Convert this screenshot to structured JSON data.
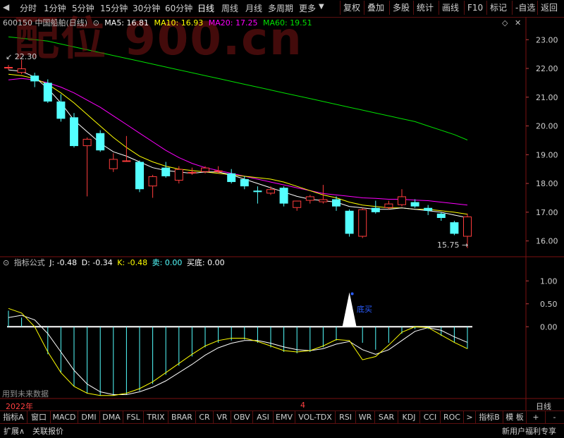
{
  "toolbar": {
    "periods": [
      "分时",
      "1分钟",
      "5分钟",
      "15分钟",
      "30分钟",
      "60分钟",
      "日线",
      "周线",
      "月线",
      "多周期",
      "更多"
    ],
    "right_buttons": [
      "复权",
      "叠加",
      "多股",
      "统计",
      "画线",
      "F10",
      "标记",
      "-自选",
      "返回"
    ]
  },
  "watermark": "配位 900.cn",
  "header": {
    "code_name": "600150 中国船舶(日线)",
    "ma5": "MA5: 16.81",
    "ma10": "MA10: 16.93",
    "ma20": "MA20: 17.25",
    "ma60": "MA60: 19.51"
  },
  "price_axis": [
    "23.00",
    "22.00",
    "21.00",
    "20.00",
    "19.00",
    "18.00",
    "17.00",
    "16.00"
  ],
  "annotations": {
    "high": "22.30",
    "low": "15.75"
  },
  "indicator": {
    "title": "指标公式",
    "j": "J: -0.48",
    "d": "D: -0.34",
    "k": "K: -0.48",
    "sell": "卖: 0.00",
    "buy_bottom": "买底: 0.00",
    "signal_label": "底买",
    "axis": [
      "1.00",
      "0.50",
      "0.00"
    ],
    "future_note": "用到未来数据"
  },
  "date_axis": {
    "year": "2022年",
    "month": "4",
    "period": "日线"
  },
  "tabs": [
    "指标A",
    "窗口",
    "MACD",
    "DMI",
    "DMA",
    "FSL",
    "TRIX",
    "BRAR",
    "CR",
    "VR",
    "OBV",
    "ASI",
    "EMV",
    "VOL-TDX",
    "RSI",
    "WR",
    "SAR",
    "KDJ",
    "CCI",
    "ROC",
    ">",
    "指标B",
    "模 板",
    "+",
    "-"
  ],
  "status": {
    "left1": "扩展∧",
    "left2": "关联报价",
    "right": "新用户福利专享"
  },
  "colors": {
    "up": "#ff3c3c",
    "down": "#54ffff",
    "ma5": "#ffffff",
    "ma10": "#ffff00",
    "ma20": "#ff00ff",
    "ma60": "#00e000",
    "grid": "#7a1010"
  },
  "chart_data": {
    "type": "candlestick",
    "price_range": [
      15.5,
      23.35
    ],
    "candles": [
      {
        "o": 22.05,
        "h": 22.12,
        "l": 21.95,
        "c": 22.05
      },
      {
        "o": 21.85,
        "h": 22.3,
        "l": 21.8,
        "c": 22.0
      },
      {
        "o": 21.75,
        "h": 21.85,
        "l": 21.35,
        "c": 21.55
      },
      {
        "o": 21.5,
        "h": 21.62,
        "l": 20.8,
        "c": 20.85
      },
      {
        "o": 20.85,
        "h": 21.1,
        "l": 20.15,
        "c": 20.25
      },
      {
        "o": 20.3,
        "h": 20.45,
        "l": 19.25,
        "c": 19.3
      },
      {
        "o": 19.3,
        "h": 19.6,
        "l": 17.55,
        "c": 19.55
      },
      {
        "o": 19.75,
        "h": 19.85,
        "l": 19.1,
        "c": 19.15
      },
      {
        "o": 18.5,
        "h": 19.05,
        "l": 18.4,
        "c": 18.85
      },
      {
        "o": 18.8,
        "h": 19.65,
        "l": 18.75,
        "c": 18.8
      },
      {
        "o": 18.75,
        "h": 18.8,
        "l": 17.7,
        "c": 17.8
      },
      {
        "o": 17.9,
        "h": 18.3,
        "l": 17.5,
        "c": 18.25
      },
      {
        "o": 18.55,
        "h": 18.75,
        "l": 18.2,
        "c": 18.25
      },
      {
        "o": 18.1,
        "h": 18.6,
        "l": 18.0,
        "c": 18.5
      },
      {
        "o": 18.35,
        "h": 18.55,
        "l": 18.3,
        "c": 18.4
      },
      {
        "o": 18.4,
        "h": 18.6,
        "l": 18.35,
        "c": 18.55
      },
      {
        "o": 18.4,
        "h": 18.6,
        "l": 18.35,
        "c": 18.45
      },
      {
        "o": 18.35,
        "h": 18.5,
        "l": 18.0,
        "c": 18.05
      },
      {
        "o": 18.15,
        "h": 18.25,
        "l": 17.8,
        "c": 17.9
      },
      {
        "o": 17.75,
        "h": 17.9,
        "l": 17.3,
        "c": 17.7
      },
      {
        "o": 17.65,
        "h": 17.9,
        "l": 17.6,
        "c": 17.8
      },
      {
        "o": 17.85,
        "h": 17.9,
        "l": 17.2,
        "c": 17.3
      },
      {
        "o": 17.15,
        "h": 17.4,
        "l": 17.05,
        "c": 17.4
      },
      {
        "o": 17.4,
        "h": 17.6,
        "l": 17.3,
        "c": 17.55
      },
      {
        "o": 17.35,
        "h": 17.95,
        "l": 17.3,
        "c": 17.45
      },
      {
        "o": 17.45,
        "h": 17.55,
        "l": 17.05,
        "c": 17.2
      },
      {
        "o": 17.05,
        "h": 17.1,
        "l": 16.15,
        "c": 16.25
      },
      {
        "o": 16.15,
        "h": 17.15,
        "l": 16.1,
        "c": 17.1
      },
      {
        "o": 17.15,
        "h": 17.4,
        "l": 16.95,
        "c": 17.0
      },
      {
        "o": 17.15,
        "h": 17.4,
        "l": 17.1,
        "c": 17.3
      },
      {
        "o": 17.25,
        "h": 17.8,
        "l": 17.2,
        "c": 17.55
      },
      {
        "o": 17.35,
        "h": 17.45,
        "l": 17.15,
        "c": 17.2
      },
      {
        "o": 17.15,
        "h": 17.25,
        "l": 16.9,
        "c": 17.05
      },
      {
        "o": 16.95,
        "h": 17.0,
        "l": 16.7,
        "c": 16.8
      },
      {
        "o": 16.65,
        "h": 16.7,
        "l": 16.2,
        "c": 16.25
      },
      {
        "o": 16.15,
        "h": 16.95,
        "l": 15.75,
        "c": 16.85
      }
    ],
    "ma5": [
      21.95,
      21.9,
      21.7,
      21.3,
      20.8,
      20.2,
      19.8,
      19.4,
      19.1,
      18.95,
      18.75,
      18.55,
      18.45,
      18.4,
      18.35,
      18.4,
      18.4,
      18.3,
      18.15,
      18.0,
      17.85,
      17.7,
      17.55,
      17.45,
      17.4,
      17.35,
      17.2,
      17.15,
      17.1,
      17.1,
      17.15,
      17.1,
      17.05,
      17.0,
      16.9,
      16.81
    ],
    "ma10": [
      21.8,
      21.75,
      21.65,
      21.45,
      21.15,
      20.8,
      20.4,
      20.0,
      19.6,
      19.25,
      18.95,
      18.75,
      18.6,
      18.5,
      18.45,
      18.4,
      18.35,
      18.3,
      18.25,
      18.2,
      18.15,
      18.05,
      17.9,
      17.75,
      17.6,
      17.5,
      17.35,
      17.25,
      17.2,
      17.15,
      17.15,
      17.1,
      17.1,
      17.05,
      17.0,
      16.93
    ],
    "ma20": [
      21.6,
      21.65,
      21.6,
      21.5,
      21.35,
      21.15,
      20.9,
      20.65,
      20.35,
      20.05,
      19.75,
      19.45,
      19.15,
      18.9,
      18.7,
      18.55,
      18.45,
      18.35,
      18.25,
      18.15,
      18.05,
      17.95,
      17.85,
      17.75,
      17.65,
      17.6,
      17.55,
      17.5,
      17.48,
      17.45,
      17.45,
      17.42,
      17.4,
      17.35,
      17.3,
      17.25
    ],
    "ma60": [
      23.1,
      23.05,
      23.0,
      22.95,
      22.85,
      22.75,
      22.65,
      22.55,
      22.45,
      22.35,
      22.25,
      22.15,
      22.05,
      21.95,
      21.85,
      21.75,
      21.65,
      21.55,
      21.45,
      21.35,
      21.25,
      21.15,
      21.05,
      20.95,
      20.85,
      20.75,
      20.65,
      20.55,
      20.45,
      20.35,
      20.25,
      20.15,
      20.0,
      19.85,
      19.7,
      19.51
    ],
    "indicator_range": [
      -1.55,
      1.25
    ],
    "bar_values": [
      0.35,
      0.2,
      0.0,
      -0.6,
      -1.0,
      -1.3,
      -1.45,
      -1.5,
      -1.5,
      -1.48,
      -1.4,
      -1.25,
      -1.05,
      -0.85,
      -0.65,
      -0.45,
      -0.35,
      -0.3,
      -0.28,
      -0.35,
      -0.45,
      -0.55,
      -0.58,
      -0.55,
      -0.45,
      -0.3,
      0.0,
      -0.35,
      -0.5,
      -0.35,
      -0.15,
      -0.05,
      -0.05,
      -0.2,
      -0.35,
      -0.48
    ],
    "k_line": [
      0.4,
      0.3,
      0.0,
      -0.55,
      -1.0,
      -1.3,
      -1.45,
      -1.5,
      -1.5,
      -1.45,
      -1.35,
      -1.2,
      -1.0,
      -0.8,
      -0.6,
      -0.42,
      -0.3,
      -0.25,
      -0.25,
      -0.32,
      -0.42,
      -0.52,
      -0.55,
      -0.52,
      -0.42,
      -0.28,
      -0.3,
      -0.72,
      -0.65,
      -0.4,
      -0.12,
      0.0,
      -0.02,
      -0.18,
      -0.34,
      -0.48
    ],
    "d_line": [
      0.2,
      0.25,
      0.15,
      -0.15,
      -0.55,
      -0.95,
      -1.25,
      -1.42,
      -1.48,
      -1.48,
      -1.42,
      -1.32,
      -1.18,
      -1.0,
      -0.82,
      -0.62,
      -0.46,
      -0.36,
      -0.3,
      -0.3,
      -0.36,
      -0.44,
      -0.5,
      -0.52,
      -0.48,
      -0.38,
      -0.32,
      -0.5,
      -0.6,
      -0.5,
      -0.3,
      -0.1,
      -0.02,
      -0.08,
      -0.22,
      -0.34
    ],
    "signal_index": 26,
    "signal_value": 0.75
  }
}
